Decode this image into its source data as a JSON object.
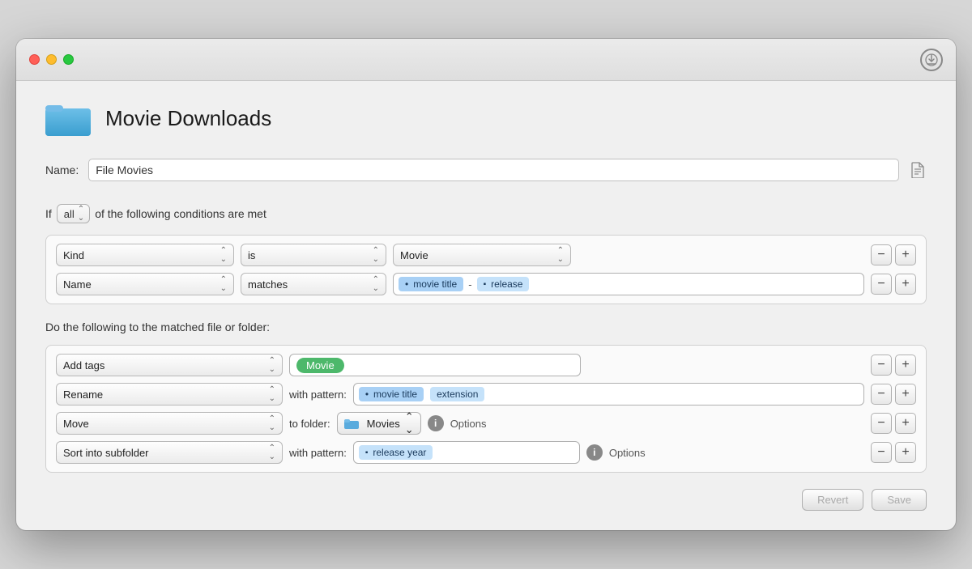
{
  "window": {
    "title": "Movie Downloads"
  },
  "header": {
    "folder_title": "Movie Downloads"
  },
  "name_row": {
    "label": "Name:",
    "value": "File Movies"
  },
  "conditions": {
    "intro_prefix": "If",
    "all_label": "all",
    "intro_suffix": "of the following conditions are met",
    "rows": [
      {
        "field": "Kind",
        "operator": "is",
        "value": "Movie"
      },
      {
        "field": "Name",
        "operator": "matches",
        "tokens": [
          {
            "type": "dot-blue",
            "label": "movie title"
          },
          {
            "type": "dash"
          },
          {
            "type": "square-blue",
            "label": "release"
          }
        ]
      }
    ]
  },
  "actions": {
    "intro": "Do the following to the matched file or folder:",
    "rows": [
      {
        "type": "add_tags",
        "action_label": "Add tags",
        "tag": "Movie"
      },
      {
        "type": "rename",
        "action_label": "Rename",
        "pattern_label": "with pattern:",
        "tokens": [
          {
            "type": "dot-blue",
            "label": "movie title"
          },
          {
            "type": "plain-blue",
            "label": "extension"
          }
        ]
      },
      {
        "type": "move",
        "action_label": "Move",
        "pattern_label": "to folder:",
        "folder": "Movies",
        "options_label": "Options"
      },
      {
        "type": "subfolder",
        "action_label": "Sort into subfolder",
        "pattern_label": "with pattern:",
        "tokens": [
          {
            "type": "square-blue",
            "label": "release year"
          }
        ],
        "options_label": "Options"
      }
    ]
  },
  "footer": {
    "revert_label": "Revert",
    "save_label": "Save"
  }
}
